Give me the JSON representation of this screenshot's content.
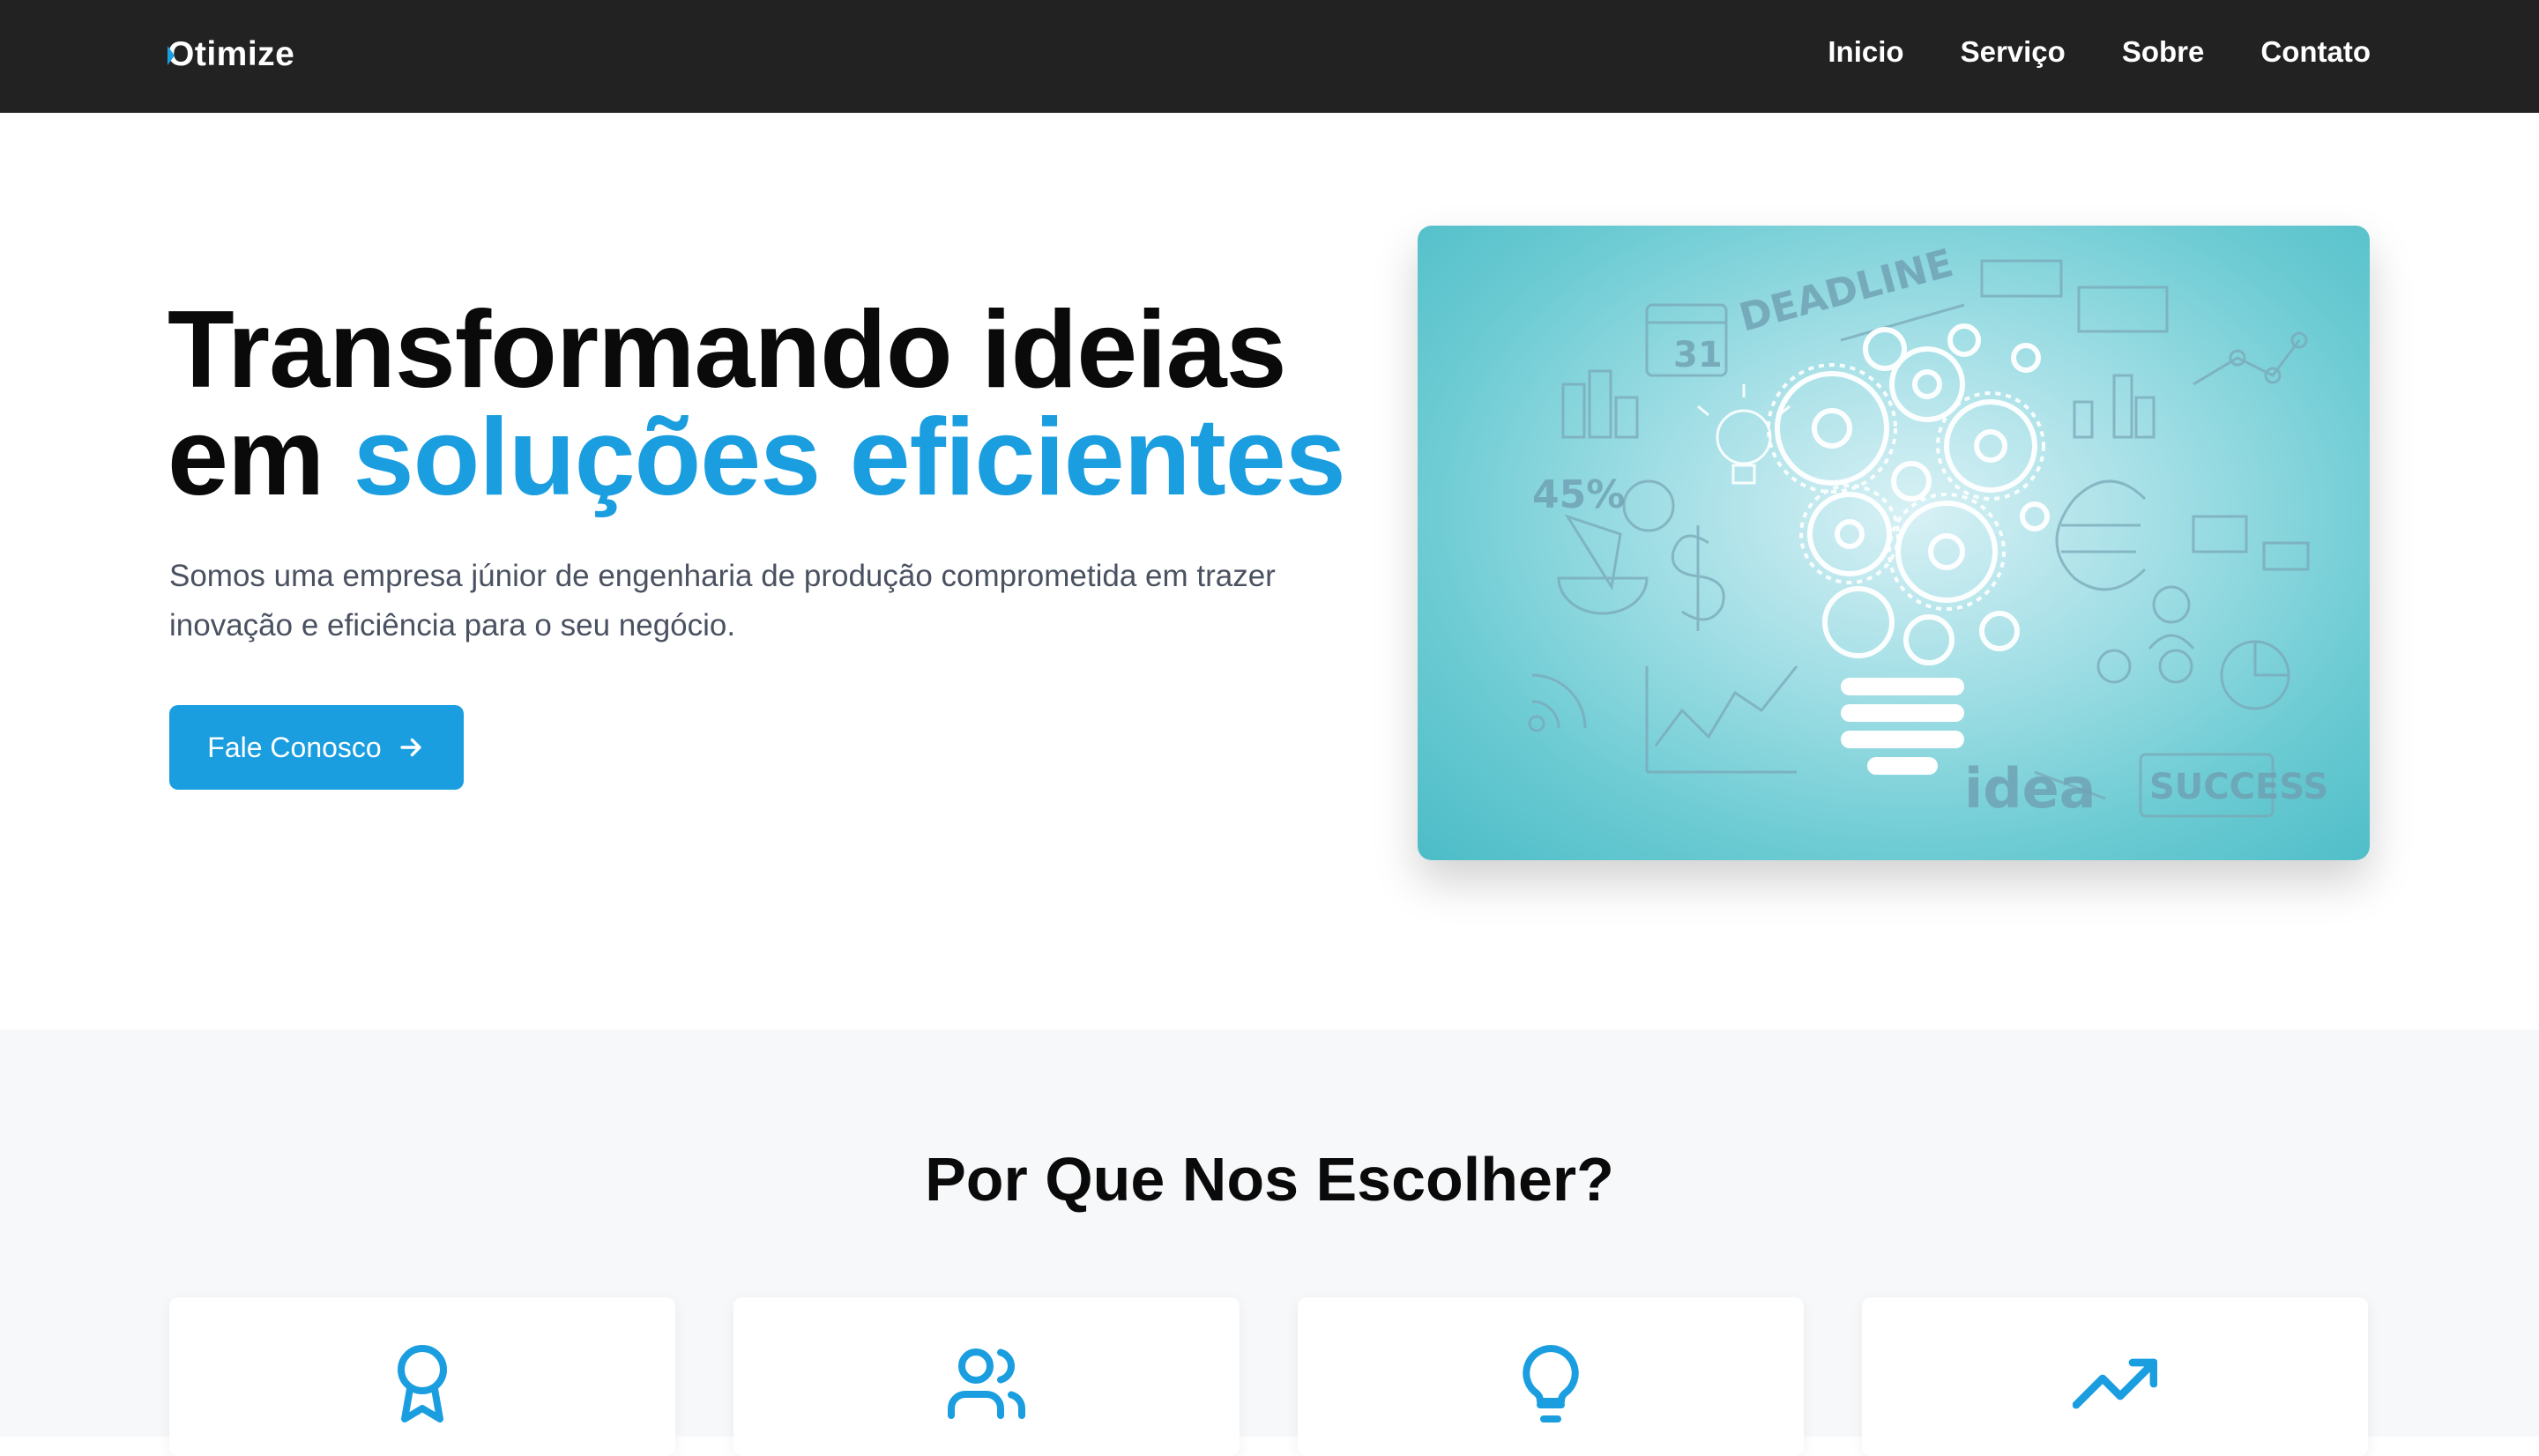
{
  "nav": {
    "logo": "Otimize",
    "links": [
      "Inicio",
      "Serviço",
      "Sobre",
      "Contato"
    ]
  },
  "hero": {
    "title_line1": "Transformando ideias",
    "title_line2_prefix": "em ",
    "title_line2_accent": "soluções eficientes",
    "subtitle": "Somos uma empresa júnior de engenharia de produção comprometida em trazer inovação e eficiência para o seu negócio.",
    "cta_label": "Fale Conosco",
    "cta_icon": "arrow-right-icon",
    "image_labels": [
      "DEADLINE",
      "31",
      "45%",
      "idea",
      "SUCCESS"
    ]
  },
  "why": {
    "title": "Por Que Nos Escolher?",
    "cards": [
      {
        "icon": "award-icon"
      },
      {
        "icon": "users-icon"
      },
      {
        "icon": "lightbulb-icon"
      },
      {
        "icon": "trending-up-icon"
      }
    ]
  },
  "colors": {
    "accent": "#1a9ee0",
    "nav_bg": "#222222",
    "section_bg": "#f7f8fa"
  }
}
